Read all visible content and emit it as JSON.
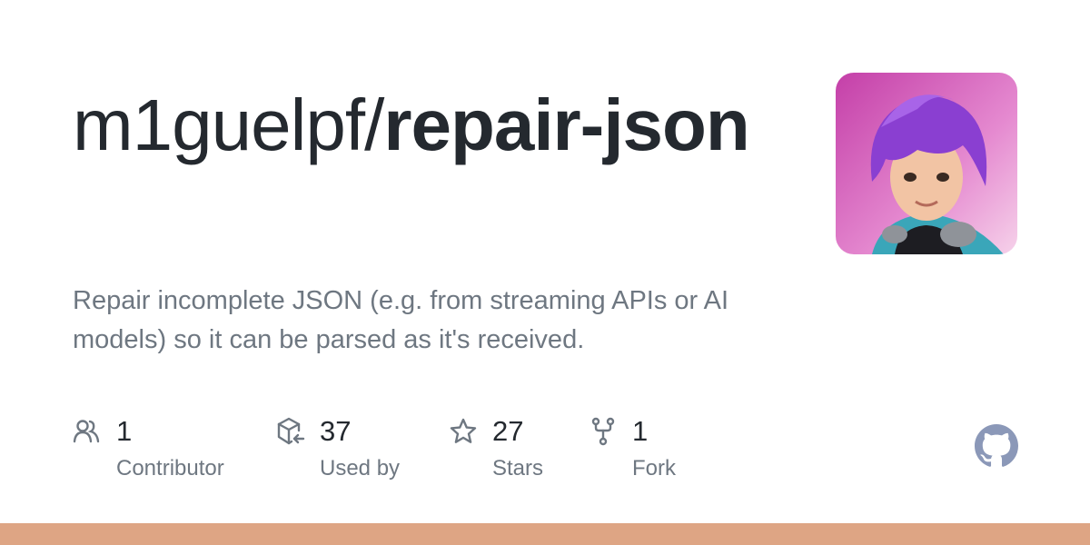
{
  "repo": {
    "owner": "m1guelpf/",
    "name": "repair-json",
    "description": "Repair incomplete JSON (e.g. from streaming APIs or AI models) so it can be parsed as it's received."
  },
  "stats": [
    {
      "icon": "people-icon",
      "value": "1",
      "label": "Contributor"
    },
    {
      "icon": "package-dependents-icon",
      "value": "37",
      "label": "Used by"
    },
    {
      "icon": "star-icon",
      "value": "27",
      "label": "Stars"
    },
    {
      "icon": "repo-forked-icon",
      "value": "1",
      "label": "Fork"
    }
  ],
  "colors": {
    "language_bar": "#dea584",
    "github_logo": "#8b98b8"
  }
}
